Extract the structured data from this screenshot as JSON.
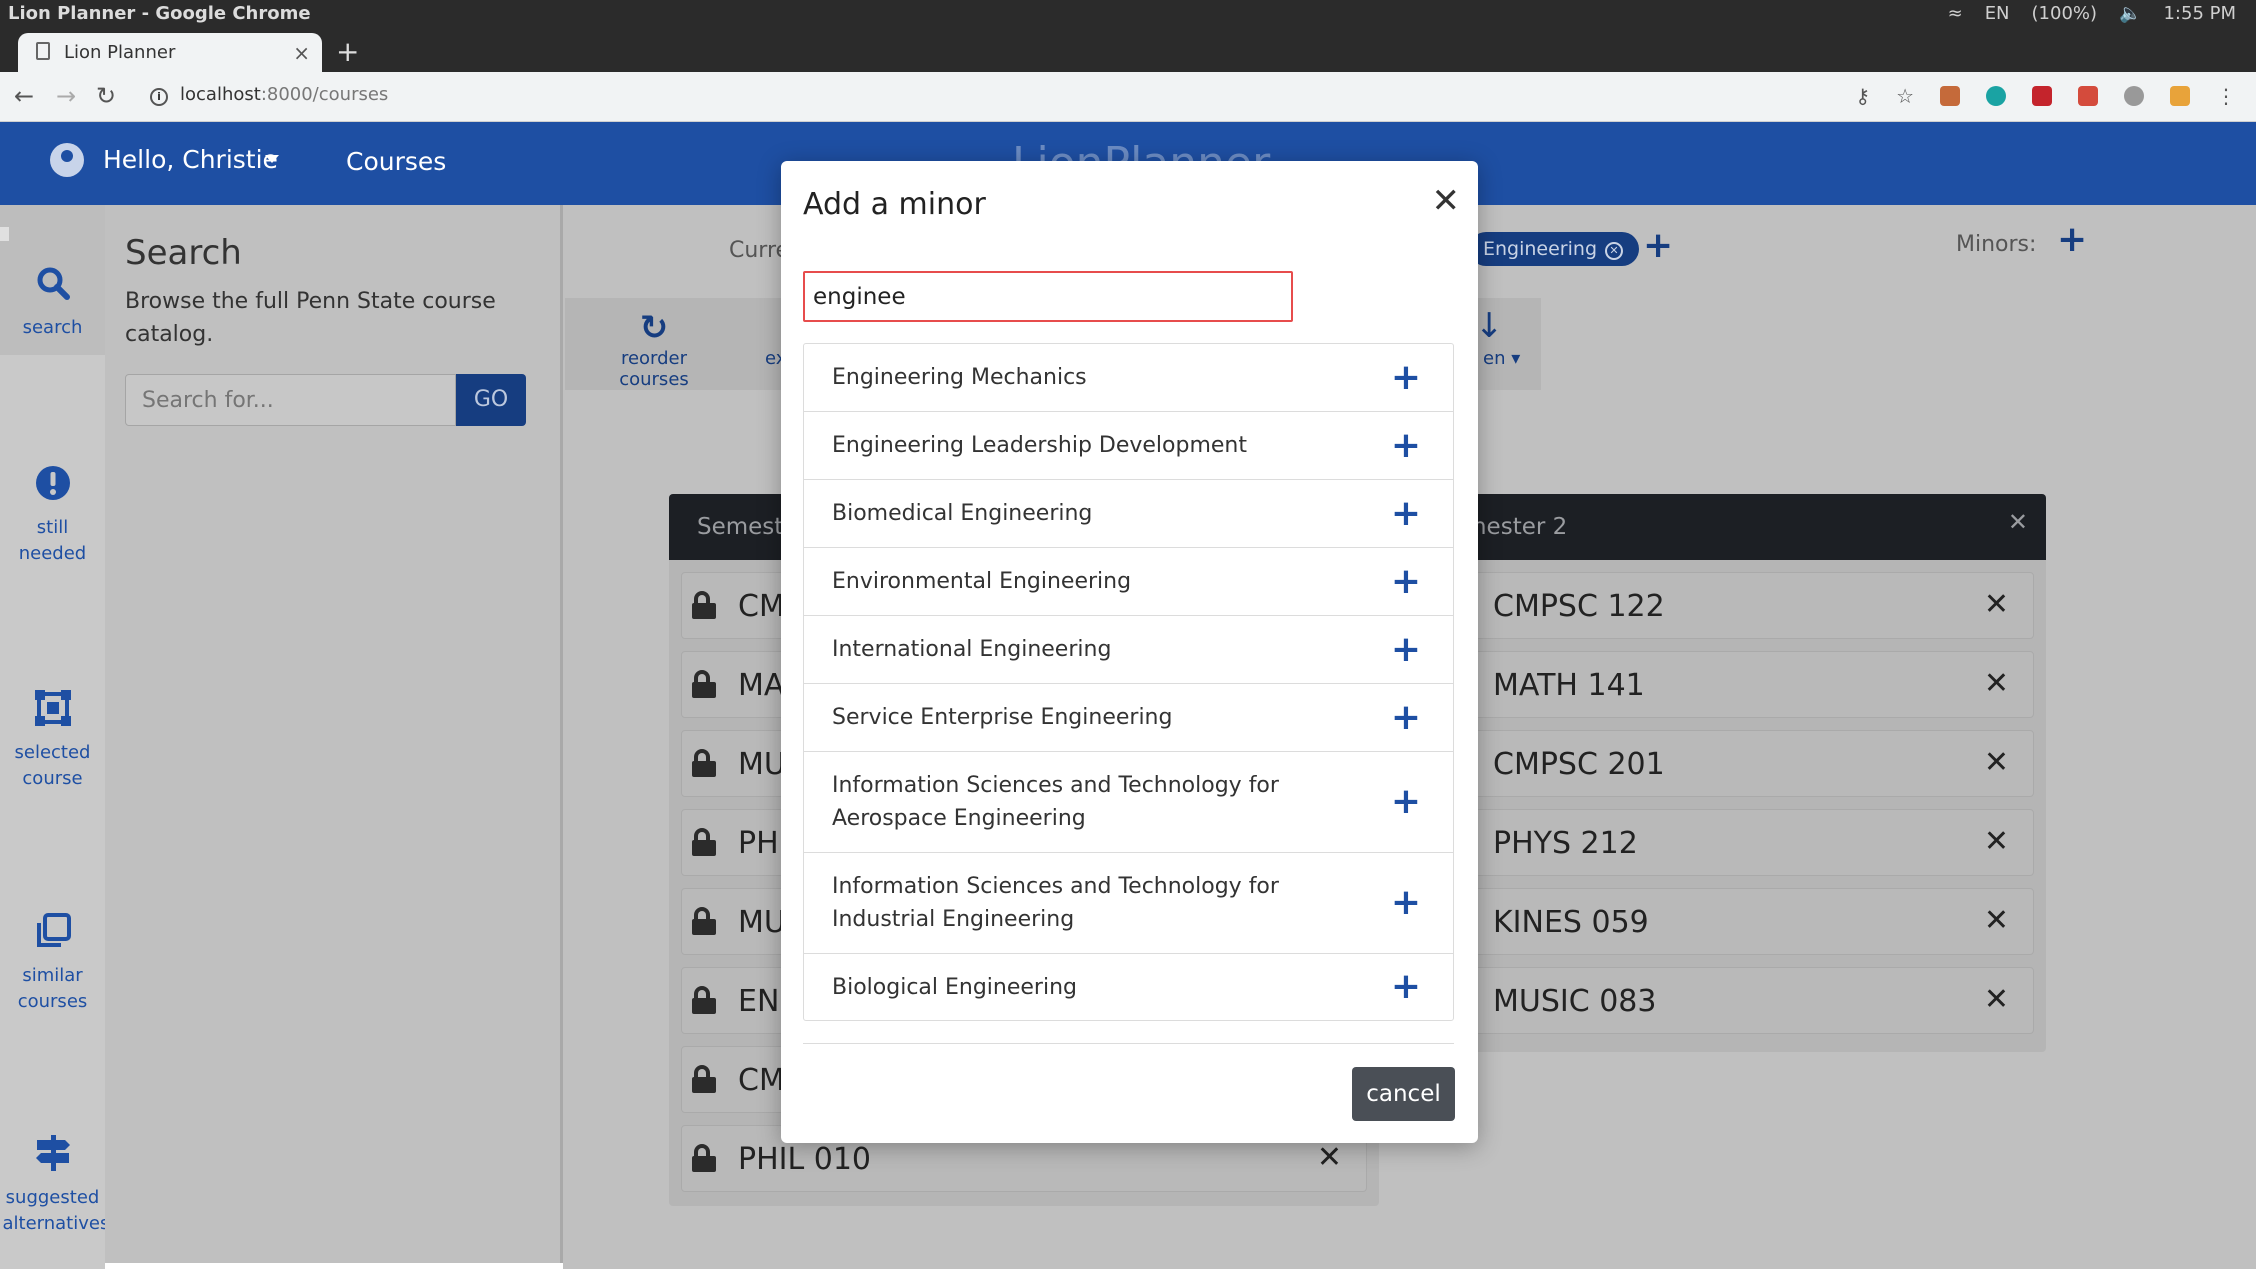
{
  "os": {
    "window_title": "Lion Planner - Google Chrome",
    "tray": [
      "EN",
      "(100%)",
      "1:55 PM"
    ]
  },
  "browser": {
    "tab_title": "Lion Planner",
    "tab_close": "×",
    "new_tab": "+",
    "url_host": "localhost",
    "url_path": ":8000/courses"
  },
  "header": {
    "greeting": "Hello, Christie",
    "nav_courses": "Courses",
    "brand": "LionPlanner"
  },
  "rail": [
    {
      "label": "search",
      "icon": "search-icon"
    },
    {
      "label": "still needed",
      "icon": "exclamation-circle-icon"
    },
    {
      "label": "selected course",
      "icon": "selection-icon"
    },
    {
      "label": "similar courses",
      "icon": "copy-icon"
    },
    {
      "label": "suggested alternatives",
      "icon": "signpost-icon"
    }
  ],
  "search_panel": {
    "title": "Search",
    "description": "Browse the full Penn State course catalog.",
    "placeholder": "Search for...",
    "go_label": "GO"
  },
  "main": {
    "current_label": "Curre",
    "major_pill": "Engineering",
    "minors_label": "Minors:",
    "toolbar": {
      "reorder_label": "reorder courses",
      "export_label": "ex",
      "download_label": "en"
    }
  },
  "semesters": [
    {
      "title": "Semeste",
      "courses": [
        "CM",
        "MA",
        "MU",
        "PH",
        "MU",
        "EN",
        "CM",
        "PHIL 010"
      ]
    },
    {
      "title": "emester 2",
      "courses": [
        "CMPSC 122",
        "MATH 141",
        "CMPSC 201",
        "PHYS 212",
        "KINES 059",
        "MUSIC 083"
      ]
    }
  ],
  "modal": {
    "title": "Add a minor",
    "input_value": "enginee",
    "minors": [
      "Engineering Mechanics",
      "Engineering Leadership Development",
      "Biomedical Engineering",
      "Environmental Engineering",
      "International Engineering",
      "Service Enterprise Engineering",
      "Information Sciences and Technology for Aerospace Engineering",
      "Information Sciences and Technology for Industrial Engineering",
      "Biological Engineering"
    ],
    "cancel_label": "cancel"
  },
  "colors": {
    "primary": "#1e4fa3",
    "input_error_border": "#e74c4c",
    "cancel_button": "#4a4f56"
  }
}
